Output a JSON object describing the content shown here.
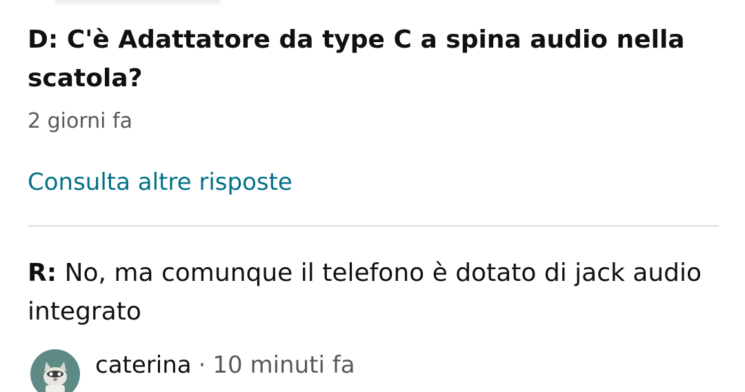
{
  "question": {
    "prefix": "D:",
    "text": "C'è Adattatore da type C a spina audio nella scatola?",
    "date": "2 giorni fa"
  },
  "links": {
    "more_answers": "Consulta altre risposte"
  },
  "answer": {
    "prefix": "R:",
    "text": "No, ma comunque il telefono è dotato di jack audio integrato",
    "author": "caterina",
    "separator": "·",
    "date": "10 minuti fa",
    "avatar_icon": "cat-avatar-icon"
  },
  "colors": {
    "link": "#007185",
    "text": "#0f1111",
    "secondary": "#565959",
    "divider": "#e7e7e7",
    "avatar_bg": "#5e8a86"
  }
}
